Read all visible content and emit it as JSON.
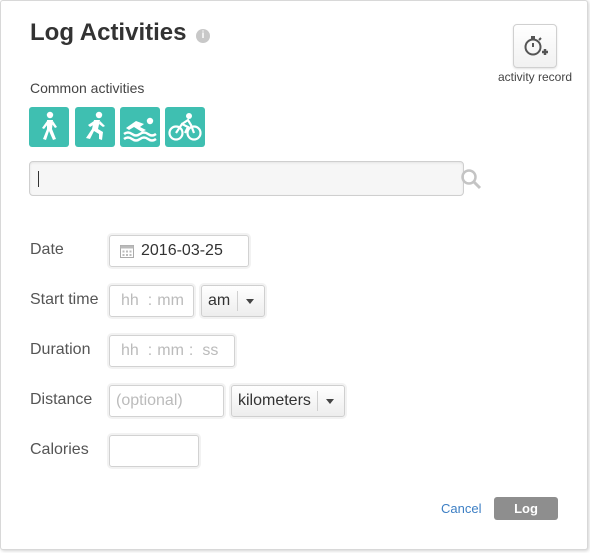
{
  "header": {
    "title": "Log Activities",
    "info_glyph": "i",
    "activity_record_label": "activity record"
  },
  "common": {
    "label": "Common activities",
    "activities": [
      {
        "icon": "walking-icon"
      },
      {
        "icon": "running-icon"
      },
      {
        "icon": "swimming-icon"
      },
      {
        "icon": "cycling-icon"
      }
    ],
    "accent_color": "#3fbfb1"
  },
  "search": {
    "value": "",
    "placeholder": ""
  },
  "form": {
    "date": {
      "label": "Date",
      "value": "2016-03-25"
    },
    "start_time": {
      "label": "Start time",
      "hh": "hh",
      "sep": ":",
      "mm": "mm",
      "ampm": "am"
    },
    "duration": {
      "label": "Duration",
      "hh": "hh",
      "mm": "mm",
      "ss": "ss",
      "sep": ":"
    },
    "distance": {
      "label": "Distance",
      "placeholder": "(optional)",
      "unit": "kilometers"
    },
    "calories": {
      "label": "Calories",
      "value": ""
    }
  },
  "actions": {
    "cancel_label": "Cancel",
    "log_label": "Log"
  }
}
